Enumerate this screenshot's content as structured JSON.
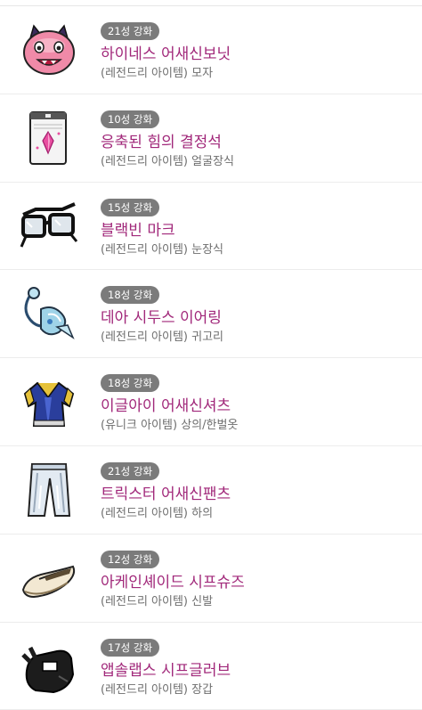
{
  "items": [
    {
      "enhance": "21성 강화",
      "name": "하이네스 어새신보닛",
      "grade": "(레전드리 아이템)",
      "slot": "모자",
      "icon": "pink-slime-hat-icon"
    },
    {
      "enhance": "10성 강화",
      "name": "응축된 힘의 결정석",
      "grade": "(레전드리 아이템)",
      "slot": "얼굴장식",
      "icon": "crystal-card-icon"
    },
    {
      "enhance": "15성 강화",
      "name": "블랙빈 마크",
      "grade": "(레전드리 아이템)",
      "slot": "눈장식",
      "icon": "glasses-icon"
    },
    {
      "enhance": "18성 강화",
      "name": "데아 시두스 이어링",
      "grade": "(레전드리 아이템)",
      "slot": "귀고리",
      "icon": "earring-icon"
    },
    {
      "enhance": "18성 강화",
      "name": "이글아이 어새신셔츠",
      "grade": "(유니크 아이템)",
      "slot": "상의/한벌옷",
      "icon": "shirt-icon"
    },
    {
      "enhance": "21성 강화",
      "name": "트릭스터 어새신팬츠",
      "grade": "(레전드리 아이템)",
      "slot": "하의",
      "icon": "pants-icon"
    },
    {
      "enhance": "12성 강화",
      "name": "아케인셰이드 시프슈즈",
      "grade": "(레전드리 아이템)",
      "slot": "신발",
      "icon": "shoe-icon"
    },
    {
      "enhance": "17성 강화",
      "name": "앱솔랩스 시프글러브",
      "grade": "(레전드리 아이템)",
      "slot": "장갑",
      "icon": "glove-icon"
    }
  ]
}
